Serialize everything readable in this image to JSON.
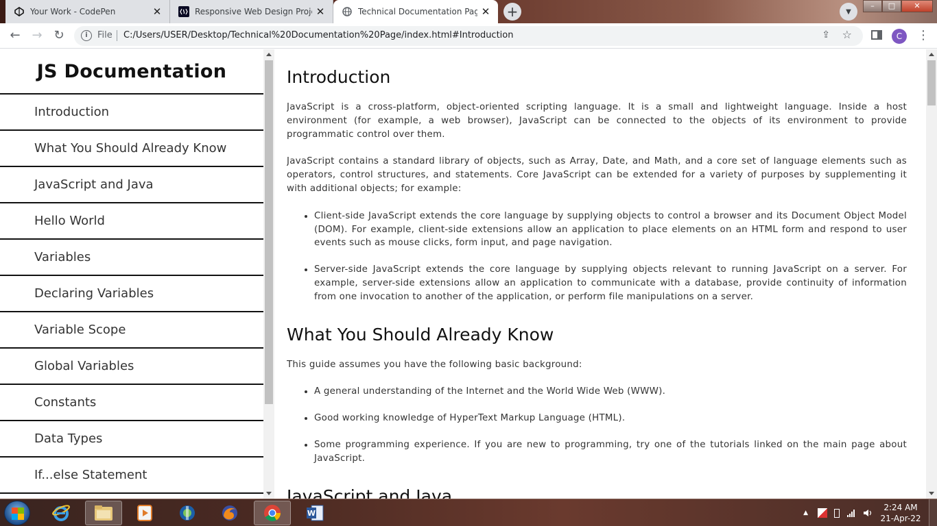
{
  "browser": {
    "tabs": [
      {
        "title": "Your Work - CodePen",
        "icon": "codepen-icon",
        "active": false
      },
      {
        "title": "Responsive Web Design Projects",
        "icon": "freecodecamp-icon",
        "active": false
      },
      {
        "title": "Technical Documentation Page P",
        "icon": "globe-icon",
        "active": true
      }
    ],
    "close_glyph": "✕",
    "new_tab_glyph": "+",
    "address": {
      "scheme_label": "File",
      "url": "C:/Users/USER/Desktop/Technical%20Documentation%20Page/index.html#Introduction"
    },
    "profile_initial": "C"
  },
  "page": {
    "nav": {
      "title": "JS Documentation",
      "links": [
        "Introduction",
        "What You Should Already Know",
        "JavaScript and Java",
        "Hello World",
        "Variables",
        "Declaring Variables",
        "Variable Scope",
        "Global Variables",
        "Constants",
        "Data Types",
        "If...else Statement"
      ]
    },
    "sections": {
      "introduction": {
        "heading": "Introduction",
        "p1": "JavaScript is a cross-platform, object-oriented scripting language. It is a small and lightweight language. Inside a host environment (for example, a web browser), JavaScript can be connected to the objects of its environment to provide programmatic control over them.",
        "p2": "JavaScript contains a standard library of objects, such as Array, Date, and Math, and a core set of language elements such as operators, control structures, and statements. Core JavaScript can be extended for a variety of purposes by supplementing it with additional objects; for example:",
        "items": [
          "Client-side JavaScript extends the core language by supplying objects to control a browser and its Document Object Model (DOM). For example, client-side extensions allow an application to place elements on an HTML form and respond to user events such as mouse clicks, form input, and page navigation.",
          "Server-side JavaScript extends the core language by supplying objects relevant to running JavaScript on a server. For example, server-side extensions allow an application to communicate with a database, provide continuity of information from one invocation to another of the application, or perform file manipulations on a server."
        ]
      },
      "what_you_should_know": {
        "heading": "What You Should Already Know",
        "p1": "This guide assumes you have the following basic background:",
        "items": [
          "A general understanding of the Internet and the World Wide Web (WWW).",
          "Good working knowledge of HyperText Markup Language (HTML).",
          "Some programming experience. If you are new to programming, try one of the tutorials linked on the main page about JavaScript."
        ]
      },
      "javascript_and_java": {
        "heading": "JavaScript and Java"
      }
    }
  },
  "taskbar": {
    "apps": [
      "windows-start-icon",
      "internet-explorer-icon",
      "file-explorer-icon",
      "media-player-icon",
      "media-center-icon",
      "firefox-icon",
      "chrome-icon",
      "word-icon"
    ],
    "clock_time": "2:24 AM",
    "clock_date": "21-Apr-22"
  },
  "colors": {
    "accent_profile": "#7e57c2",
    "page_text": "#333333",
    "divider": "#111111"
  }
}
